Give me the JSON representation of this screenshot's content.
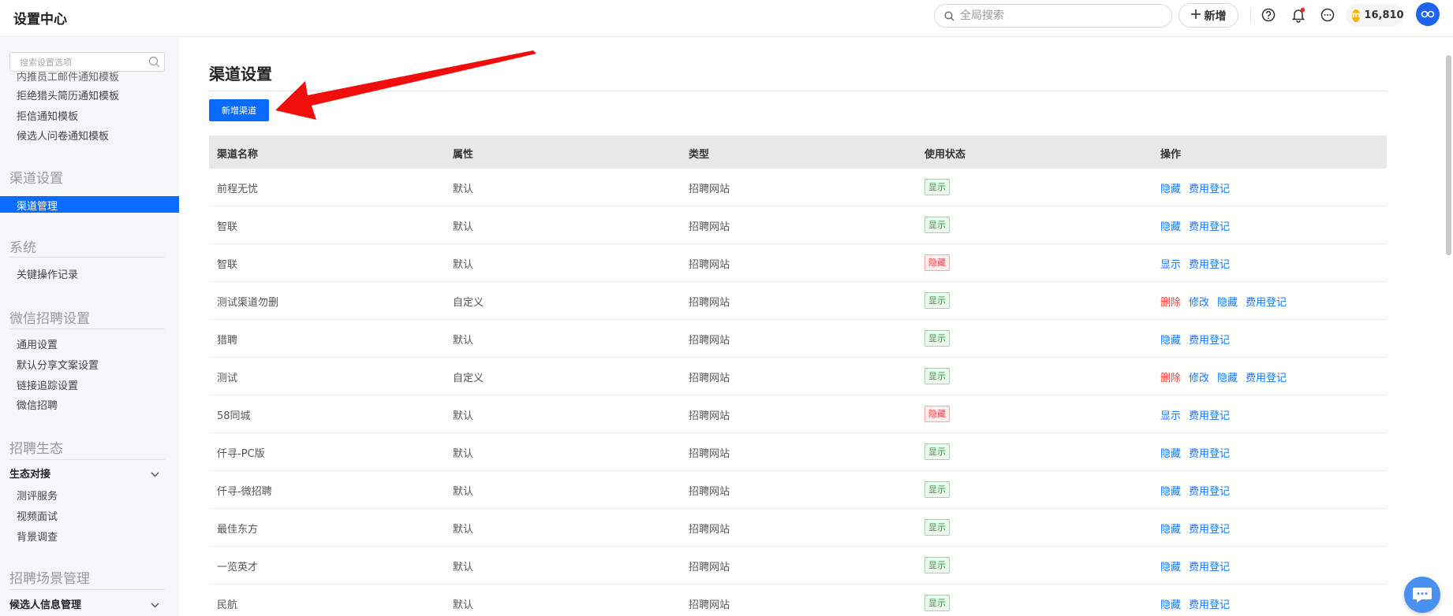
{
  "header": {
    "title": "设置中心",
    "search_placeholder": "全局搜索",
    "new_label": "新增",
    "coins": "16,810"
  },
  "sidebar": {
    "search_placeholder": "搜索设置选项",
    "partial_item": "内推员工邮件通知模板",
    "top_items": [
      "拒绝猎头简历通知模板",
      "拒信通知模板",
      "候选人问卷通知模板"
    ],
    "sections": {
      "channel": {
        "title": "渠道设置",
        "items": [
          "渠道管理"
        ]
      },
      "system": {
        "title": "系统",
        "items": [
          "关键操作记录"
        ]
      },
      "wechat": {
        "title": "微信招聘设置",
        "items": [
          "通用设置",
          "默认分享文案设置",
          "链接追踪设置",
          "微信招聘"
        ]
      },
      "eco": {
        "title": "招聘生态",
        "group": "生态对接",
        "items": [
          "测评服务",
          "视频面试",
          "背景调查"
        ]
      },
      "scene": {
        "title": "招聘场景管理",
        "group": "候选人信息管理"
      }
    }
  },
  "main": {
    "title": "渠道设置",
    "add_button": "新增渠道",
    "columns": [
      "渠道名称",
      "属性",
      "类型",
      "使用状态",
      "操作"
    ],
    "rows": [
      {
        "name": "前程无忧",
        "attr": "默认",
        "type": "招聘网站",
        "status": "显示",
        "status_kind": "show",
        "actions": [
          "隐藏",
          "费用登记"
        ]
      },
      {
        "name": "智联",
        "attr": "默认",
        "type": "招聘网站",
        "status": "显示",
        "status_kind": "show",
        "actions": [
          "隐藏",
          "费用登记"
        ]
      },
      {
        "name": "智联",
        "attr": "默认",
        "type": "招聘网站",
        "status": "隐藏",
        "status_kind": "hide",
        "actions": [
          "显示",
          "费用登记"
        ]
      },
      {
        "name": "测试渠道勿删",
        "attr": "自定义",
        "type": "招聘网站",
        "status": "显示",
        "status_kind": "show",
        "actions": [
          "删除",
          "修改",
          "隐藏",
          "费用登记"
        ]
      },
      {
        "name": "猎聘",
        "attr": "默认",
        "type": "招聘网站",
        "status": "显示",
        "status_kind": "show",
        "actions": [
          "隐藏",
          "费用登记"
        ]
      },
      {
        "name": "测试",
        "attr": "自定义",
        "type": "招聘网站",
        "status": "显示",
        "status_kind": "show",
        "actions": [
          "删除",
          "修改",
          "隐藏",
          "费用登记"
        ]
      },
      {
        "name": "58同城",
        "attr": "默认",
        "type": "招聘网站",
        "status": "隐藏",
        "status_kind": "hide",
        "actions": [
          "显示",
          "费用登记"
        ]
      },
      {
        "name": "仟寻-PC版",
        "attr": "默认",
        "type": "招聘网站",
        "status": "显示",
        "status_kind": "show",
        "actions": [
          "隐藏",
          "费用登记"
        ]
      },
      {
        "name": "仟寻-微招聘",
        "attr": "默认",
        "type": "招聘网站",
        "status": "显示",
        "status_kind": "show",
        "actions": [
          "隐藏",
          "费用登记"
        ]
      },
      {
        "name": "最佳东方",
        "attr": "默认",
        "type": "招聘网站",
        "status": "显示",
        "status_kind": "show",
        "actions": [
          "隐藏",
          "费用登记"
        ]
      },
      {
        "name": "一览英才",
        "attr": "默认",
        "type": "招聘网站",
        "status": "显示",
        "status_kind": "show",
        "actions": [
          "隐藏",
          "费用登记"
        ]
      },
      {
        "name": "民航",
        "attr": "默认",
        "type": "招聘网站",
        "status": "显示",
        "status_kind": "show",
        "actions": [
          "隐藏",
          "费用登记"
        ]
      }
    ]
  },
  "colors": {
    "primary": "#0a6cff",
    "link": "#1677ff",
    "danger": "#e84545",
    "success": "#2d9d3a",
    "arrow": "#f20d0d"
  },
  "icons": [
    "search-icon",
    "plus-icon",
    "help-icon",
    "bell-icon",
    "more-icon",
    "coin-icon",
    "avatar-icon",
    "chevron-down-icon",
    "chat-icon",
    "arrow-annotation"
  ]
}
